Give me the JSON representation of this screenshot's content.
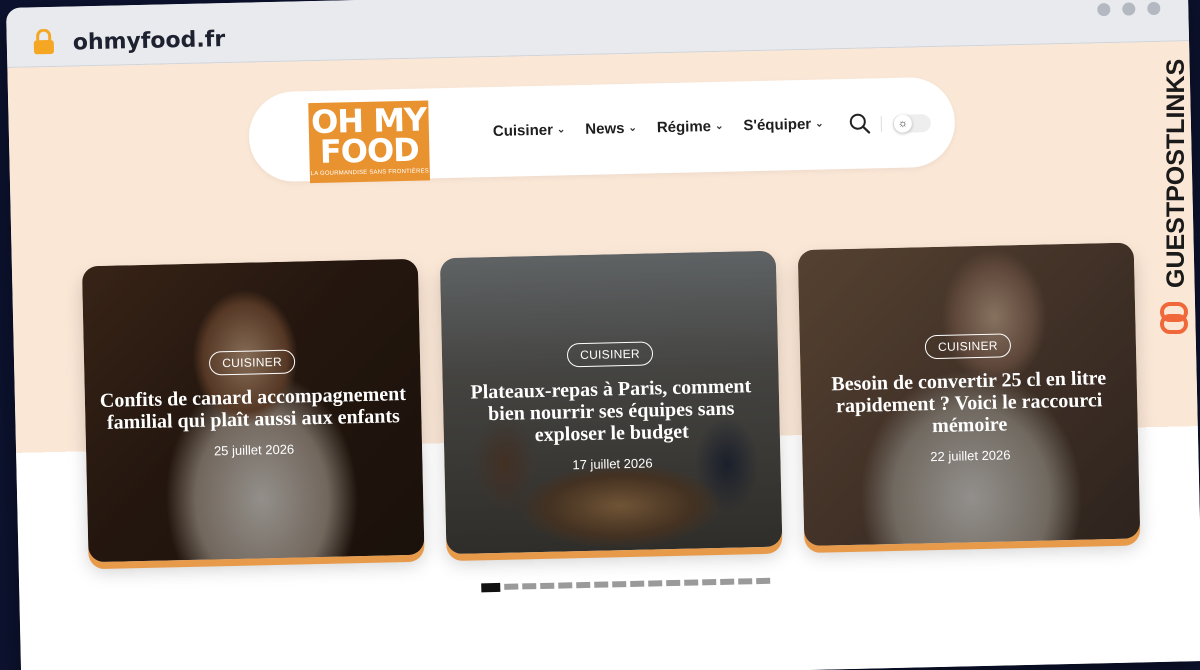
{
  "browser": {
    "url": "ohmyfood.fr",
    "lock_icon": "lock-icon"
  },
  "site": {
    "logo": {
      "line1": "OH MY",
      "line2": "FOOD",
      "tagline": "LA GOURMANDISE SANS FRONTIÈRES",
      "color": "#e99330"
    },
    "nav": [
      {
        "label": "Cuisiner"
      },
      {
        "label": "News"
      },
      {
        "label": "Régime"
      },
      {
        "label": "S'équiper"
      }
    ],
    "accent": "#e79a4a",
    "hero_bg": "#fbe7d6"
  },
  "slider": {
    "cards": [
      {
        "category": "CUISINER",
        "title": "Confits de canard accompagnement familial qui plaît aussi aux enfants",
        "date": "25 juillet 2026"
      },
      {
        "category": "CUISINER",
        "title": "Plateaux-repas à Paris, comment bien nourrir ses équipes sans exploser le budget",
        "date": "17 juillet 2026"
      },
      {
        "category": "CUISINER",
        "title": "Besoin de convertir 25 cl en litre rapidement ? Voici le raccourci mémoire",
        "date": "22 juillet 2026"
      }
    ],
    "active_page": 1,
    "page_count": 16
  },
  "watermark": {
    "text": "GUESTPOSTLINKS",
    "color": "#f0673a"
  }
}
